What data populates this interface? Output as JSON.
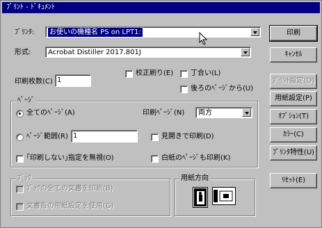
{
  "window": {
    "title": "ﾌﾟﾘﾝﾄ - ﾄﾞｷｭﾒﾝﾄ"
  },
  "printer": {
    "label": "ﾌﾟﾘﾝﾀ:",
    "value": "お使いの機種名 PS on LPT1:"
  },
  "format": {
    "label": "形式:",
    "value": "Acrobat Distiller 2017.801J"
  },
  "copies": {
    "label": "印刷枚数(C)",
    "value": "1"
  },
  "options": {
    "proof": "校正刷り(E)",
    "collate": "丁合い(L)",
    "reverse": "後ろのﾍﾟｰｼﾞから(U)"
  },
  "pages": {
    "group_label": "ﾍﾟｰｼﾞ",
    "all": "全てのﾍﾟｰｼﾞ(A)",
    "print_pages_label": "印刷ﾍﾟｰｼﾞ(N)",
    "print_pages_value": "両方",
    "range": "ﾍﾟｰｼﾞ範囲(R)",
    "range_value": "1",
    "spread": "見開きで印刷(D)",
    "ignore_nonprint": "｢印刷しない｣指定を無視(O)",
    "blank_pages": "白紙のﾍﾟｰｼﾞも印刷(K)"
  },
  "book": {
    "group_label": "ﾌﾞｯｸ",
    "all_docs": "ﾌﾞｯｸの全ての文書を印刷(B)",
    "paper_per_doc": "文書毎の用紙設定を使用(G)"
  },
  "orientation": {
    "group_label": "用紙方向"
  },
  "buttons": {
    "print": "印刷",
    "cancel": "ｷｬﾝｾﾙ",
    "print_setup": "ﾌﾟﾘﾝﾄ設定(D)",
    "page_setup": "用紙設定(P)",
    "options": "ｵﾌﾟｼｮﾝ(T)",
    "color": "ｶﾗｰ(C)",
    "printer_props": "ﾌﾟﾘﾝﾀ特性(U)",
    "reset": "ﾘｾｯﾄ(E)"
  }
}
